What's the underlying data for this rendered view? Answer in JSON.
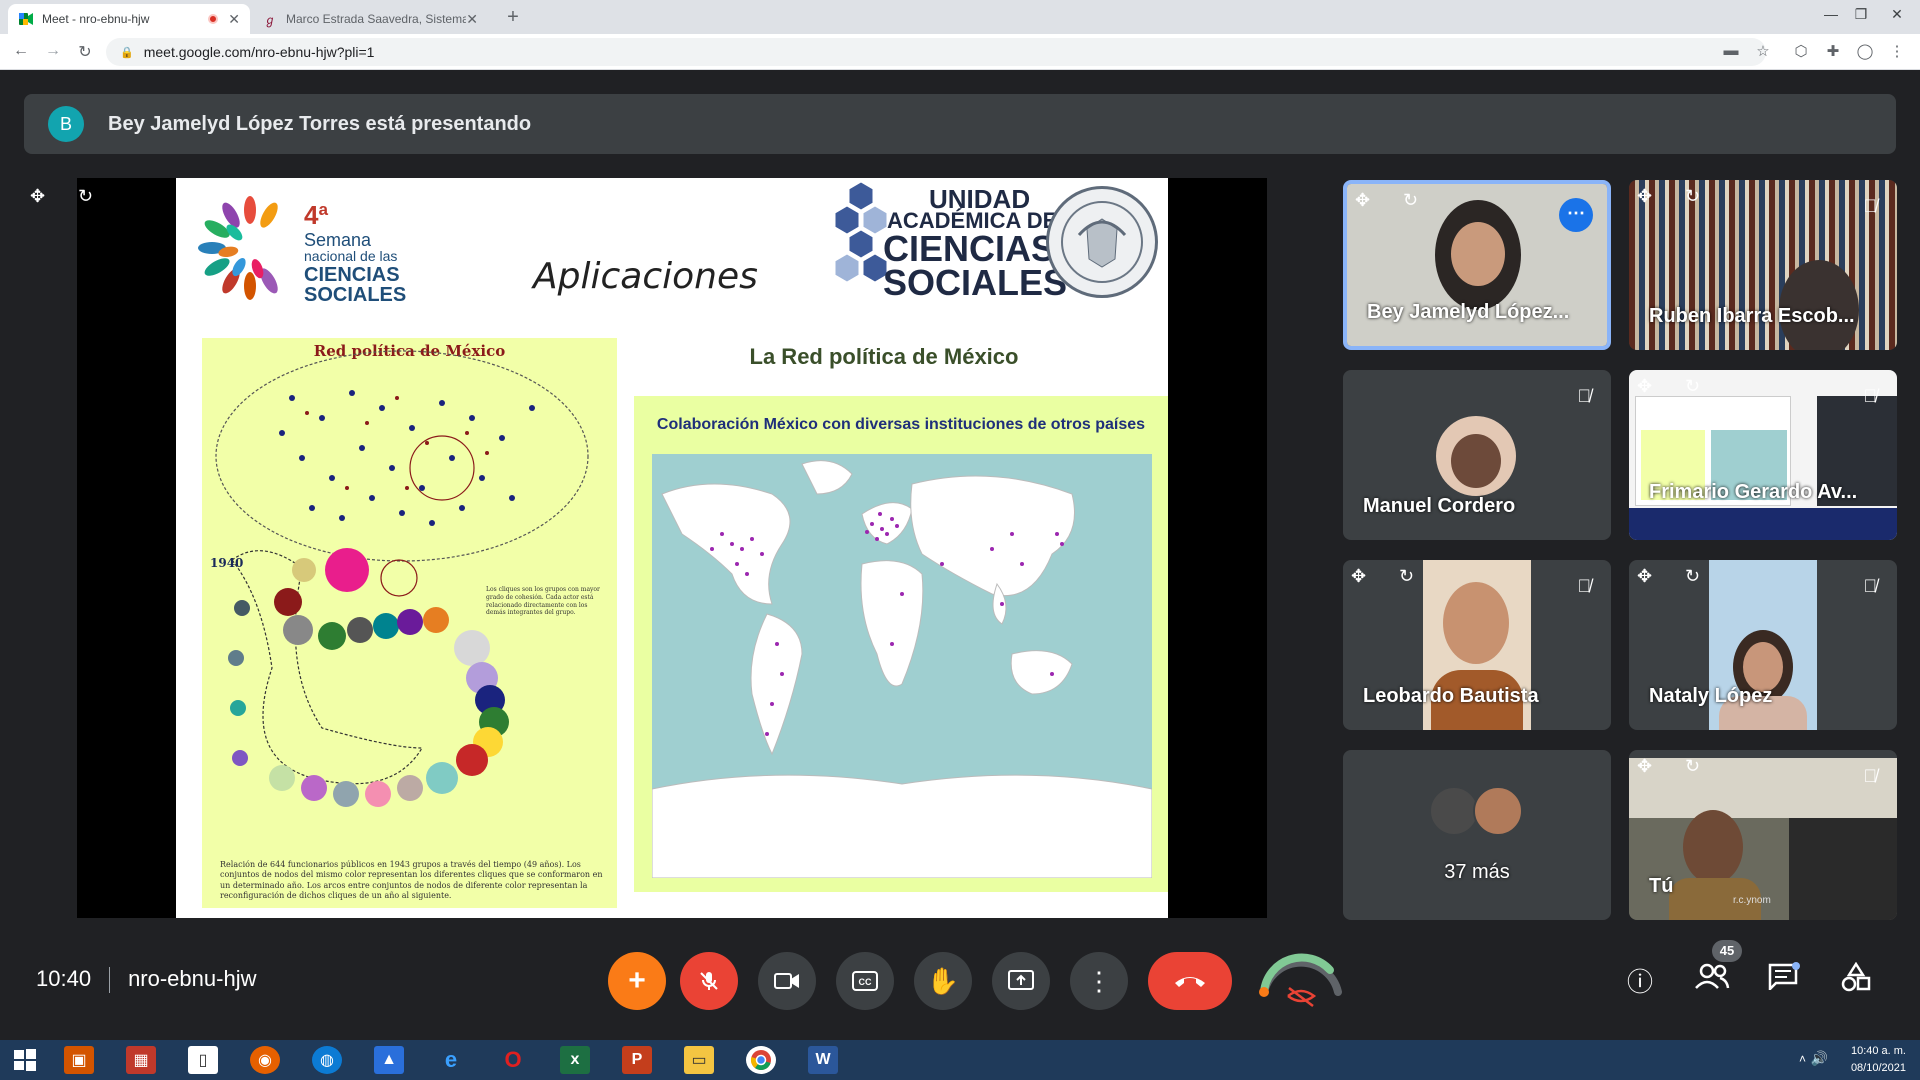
{
  "browser": {
    "tabs": [
      {
        "title": "Meet - nro-ebnu-hjw",
        "active": true,
        "recording": true
      },
      {
        "title": "Marco Estrada Saavedra, Sistema",
        "active": false
      }
    ],
    "url": "meet.google.com/nro-ebnu-hjw?pli=1"
  },
  "meet": {
    "presenting_banner": {
      "avatar_letter": "B",
      "text": "Bey Jamelyd López Torres está presentando"
    },
    "slide": {
      "title": "Aplicaciones",
      "logo_left": {
        "edition": "4ª",
        "line1": "Semana",
        "line2": "nacional de las",
        "line3": "CIENCIAS",
        "line4": "SOCIALES"
      },
      "logo_right": {
        "line1": "UNIDAD",
        "line2": "ACADÉMICA DE",
        "line3": "CIENCIAS",
        "line4": "SOCIALES"
      },
      "network_title": "Red política de México",
      "network_year": "1940",
      "network_note": "Los cliques son los grupos con mayor grado de cohesión. Cada actor está relacionado directamente con los demás integrantes del grupo.",
      "network_caption": "Relación de 644 funcionarios públicos en 1943 grupos a través del tiempo (49 años). Los conjuntos de nodos del mismo color representan los diferentes cliques que se conformaron en un determinado año. Los arcos entre conjuntos de nodos de diferente color representan la reconfiguración de dichos cliques de un año al siguiente.",
      "right_title": "La Red política de México",
      "map_title": "Colaboración México con diversas instituciones de otros países"
    },
    "participants": [
      {
        "name": "Bey Jamelyd López...",
        "muted": false,
        "active": true
      },
      {
        "name": "Ruben Ibarra Escob...",
        "muted": true
      },
      {
        "name": "Manuel Cordero",
        "muted": true
      },
      {
        "name": "Frimario Gerardo Av...",
        "muted": true
      },
      {
        "name": "Leobardo Bautista",
        "muted": true
      },
      {
        "name": "Nataly López",
        "muted": true
      },
      {
        "name": "37 más"
      },
      {
        "name": "Tú",
        "muted": true
      }
    ],
    "self_tile_overlay": "r.c.ynom",
    "time": "10:40",
    "meeting_code": "nro-ebnu-hjw",
    "participant_count": "45",
    "colors": {
      "accent": "#1a73e8",
      "end_call": "#ea4335",
      "activity": "#fa7b17",
      "background": "#202124"
    }
  },
  "taskbar": {
    "time": "10:40 a. m.",
    "date": "08/10/2021"
  }
}
